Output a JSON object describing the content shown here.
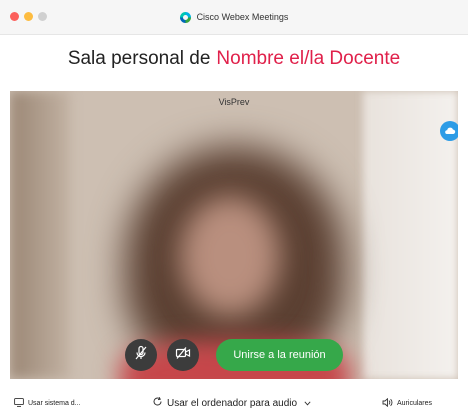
{
  "window": {
    "app_title": "Cisco Webex Meetings"
  },
  "room": {
    "prefix": "Sala personal de",
    "name": "Nombre el/la Docente"
  },
  "preview": {
    "label": "VisPrev",
    "join_label": "Unirse a la reunión"
  },
  "bottom": {
    "system_label": "Usar sistema d...",
    "audio_label": "Usar el ordenador para audio",
    "speaker_label": "Auriculares"
  },
  "colors": {
    "accent_name": "#e0204a",
    "join_button": "#36a84a",
    "badge": "#2d9ce6"
  },
  "icons": [
    "webex-logo-icon",
    "mic-muted-icon",
    "video-off-icon",
    "cloud-icon",
    "screen-share-icon",
    "audio-refresh-icon",
    "speaker-icon",
    "chevron-down-icon"
  ]
}
